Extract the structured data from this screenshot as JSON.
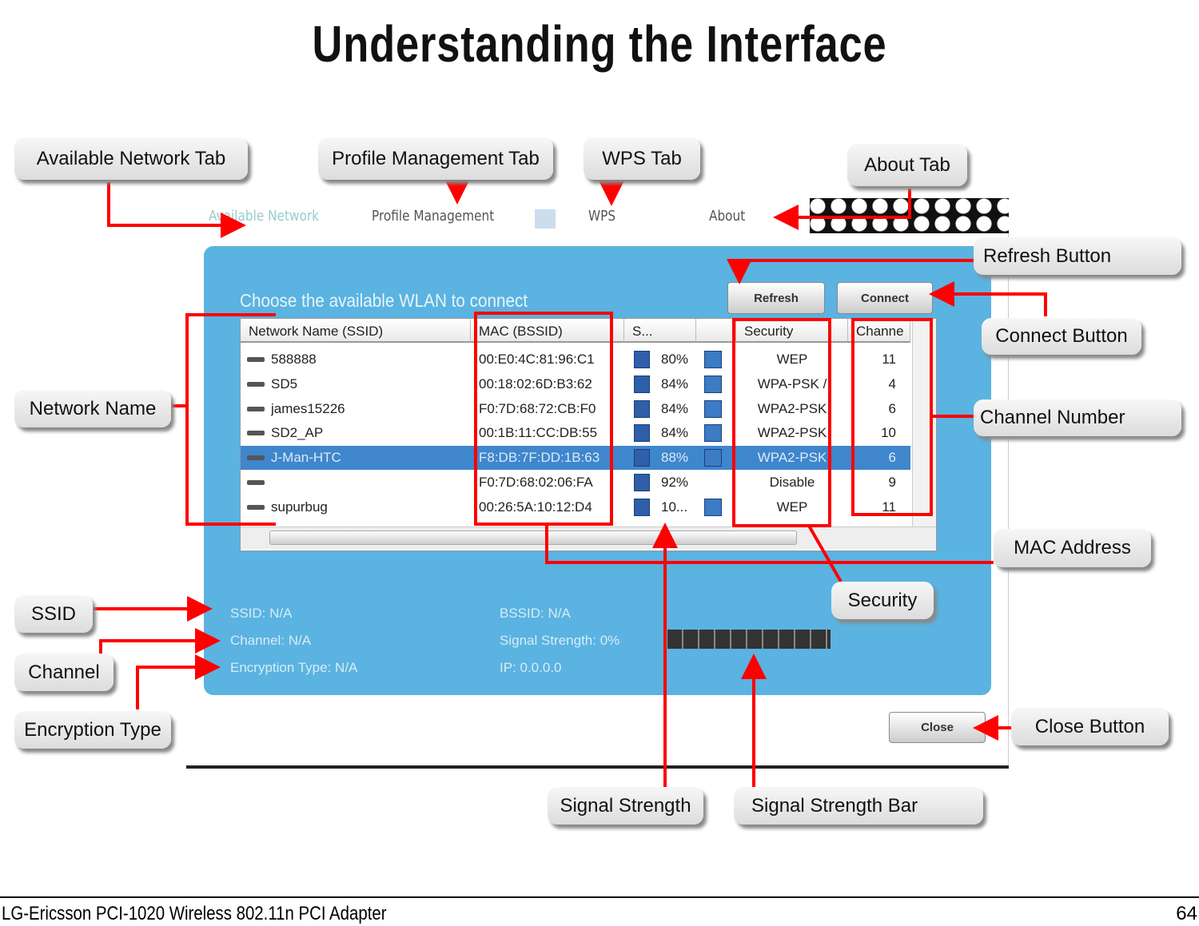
{
  "title": "Understanding the Interface",
  "app": {
    "tabs": [
      "Available Network",
      "Profile Management",
      "WPS",
      "About"
    ],
    "heading": "Choose the available WLAN to connect",
    "refresh": "Refresh",
    "connect": "Connect",
    "close": "Close",
    "columns": [
      "Network Name (SSID)",
      "MAC (BSSID)",
      "S...",
      "Security",
      "Channe"
    ],
    "rows": [
      {
        "name": "588888",
        "mac": "00:E0:4C:81:96:C1",
        "signal": "80%",
        "security": "WEP",
        "channel": "11",
        "lock": true
      },
      {
        "name": "SD5",
        "mac": "00:18:02:6D:B3:62",
        "signal": "84%",
        "security": "WPA-PSK /",
        "channel": "4",
        "lock": true
      },
      {
        "name": "james15226",
        "mac": "F0:7D:68:72:CB:F0",
        "signal": "84%",
        "security": "WPA2-PSK",
        "channel": "6",
        "lock": true
      },
      {
        "name": "SD2_AP",
        "mac": "00:1B:11:CC:DB:55",
        "signal": "84%",
        "security": "WPA2-PSK",
        "channel": "10",
        "lock": true
      },
      {
        "name": "J-Man-HTC",
        "mac": "F8:DB:7F:DD:1B:63",
        "signal": "88%",
        "security": "WPA2-PSK",
        "channel": "6",
        "lock": true,
        "selected": true
      },
      {
        "name": "",
        "mac": "F0:7D:68:02:06:FA",
        "signal": "92%",
        "security": "Disable",
        "channel": "9",
        "lock": false
      },
      {
        "name": "supurbug",
        "mac": "00:26:5A:10:12:D4",
        "signal": "10...",
        "security": "WEP",
        "channel": "11",
        "lock": true
      }
    ],
    "info": {
      "ssid": "SSID: N/A",
      "channel": "Channel: N/A",
      "encryption": "Encryption Type: N/A",
      "bssid": "BSSID: N/A",
      "signal": "Signal Strength: 0%",
      "ip": "IP: 0.0.0.0"
    },
    "signal_level_percent": 0
  },
  "callouts": {
    "available": "Available Network Tab",
    "profile": "Profile Management Tab",
    "wps": "WPS Tab",
    "about": "About Tab",
    "refresh": "Refresh Button",
    "connect": "Connect Button",
    "netname": "Network Name",
    "channelnum": "Channel Number",
    "mac": "MAC Address",
    "security": "Security",
    "ssid": "SSID",
    "channel": "Channel",
    "enc": "Encryption Type",
    "close": "Close Button",
    "signal": "Signal Strength",
    "signalbar": "Signal Strength Bar"
  },
  "footer": {
    "product": "LG-Ericsson PCI-1020 Wireless 802.11n PCI Adapter",
    "page": "64"
  }
}
